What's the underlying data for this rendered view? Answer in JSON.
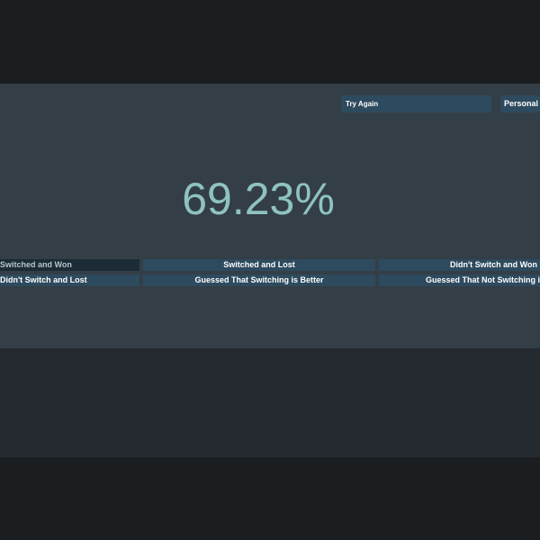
{
  "header": {
    "try_again_label": "Try Again",
    "personal_label": "Personal Results"
  },
  "result": {
    "percentage": "69.23%"
  },
  "stats": {
    "row1": [
      "Switched and Won",
      "Switched and Lost",
      "Didn't Switch and Won"
    ],
    "row2": [
      "Didn't Switch and Lost",
      "Guessed That Switching is Better",
      "Guessed That Not Switching is Better"
    ]
  },
  "colors": {
    "accent": "#8ec3c0",
    "button": "#2d4a5e",
    "button_active": "#1b2c37",
    "panel": "#343e46"
  }
}
